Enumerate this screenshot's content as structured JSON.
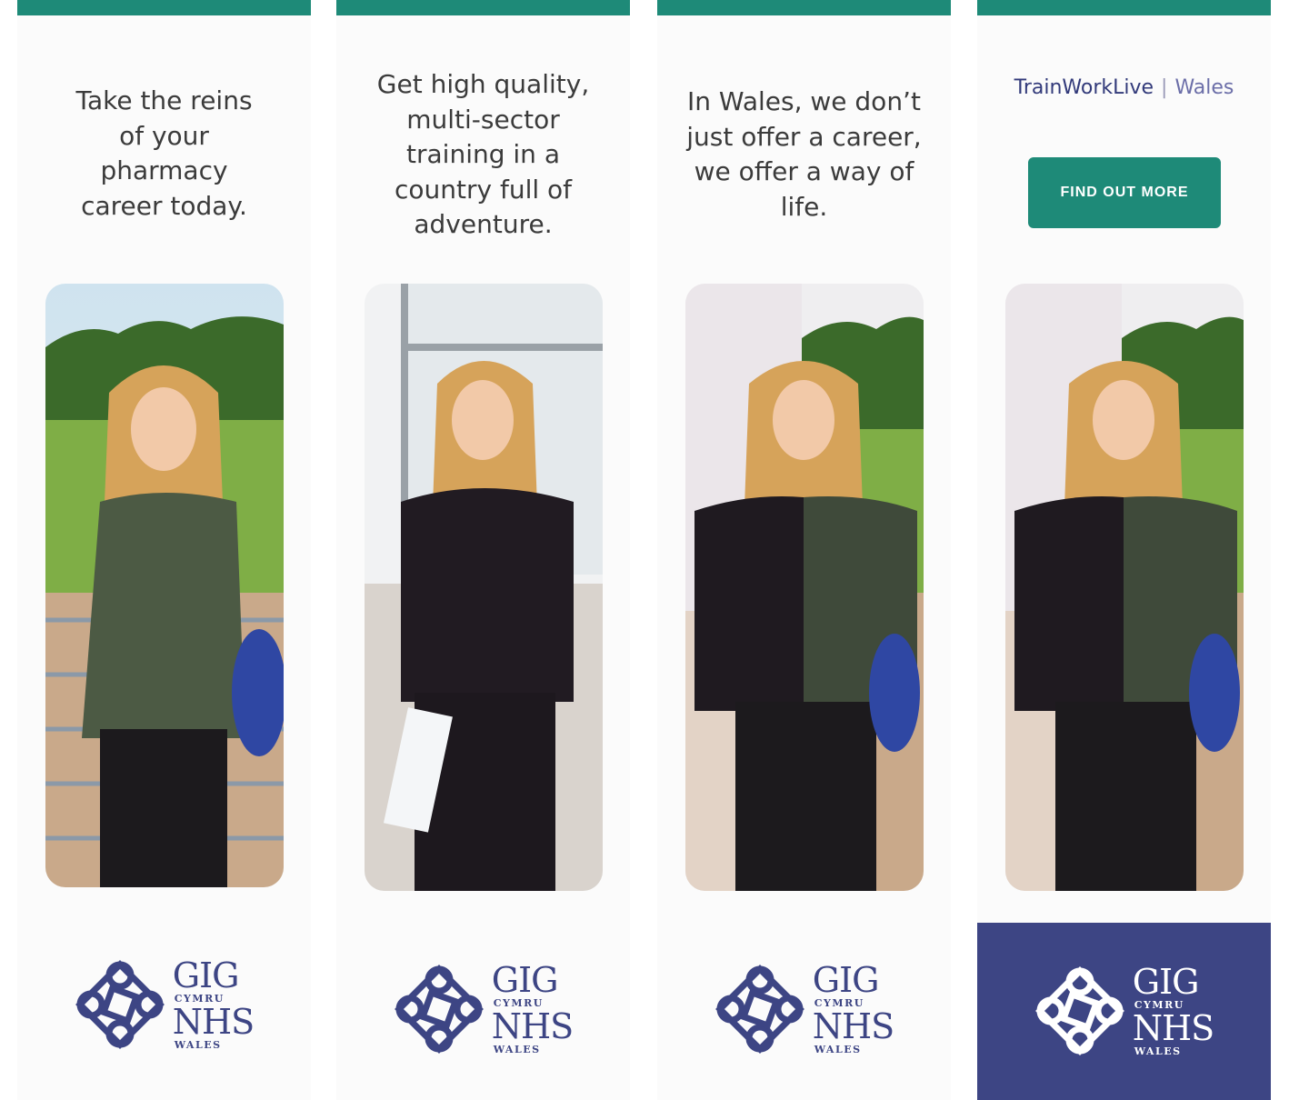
{
  "panels": [
    {
      "headline": "Take the reins of your pharmacy career today."
    },
    {
      "headline": "Get high quality, multi-sector training in a country full of adventure."
    },
    {
      "headline": "In Wales, we don’t just offer a career, we offer a way of life."
    },
    {
      "brand": {
        "name": "TrainWorkLive",
        "region": "Wales"
      },
      "cta_label": "FIND OUT MORE"
    }
  ],
  "logo": {
    "line1": "GIG",
    "line2": "CYMRU",
    "line3": "NHS",
    "line4": "WALES"
  },
  "colors": {
    "teal": "#1e8a78",
    "navy": "#3d4584",
    "logo_blue": "#3d4584",
    "text": "#3b3b3b"
  }
}
